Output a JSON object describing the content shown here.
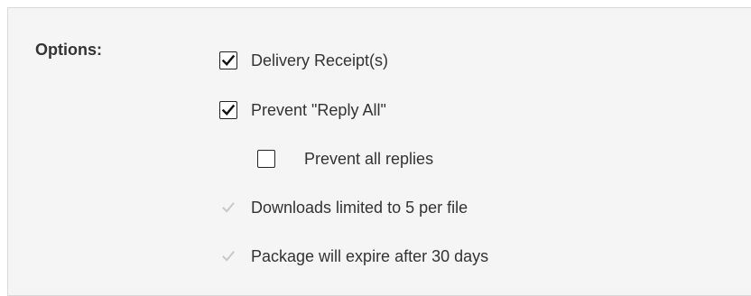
{
  "options_heading": "Options:",
  "options": [
    {
      "label": "Delivery Receipt(s)",
      "checked": true,
      "enabled": true
    },
    {
      "label": "Prevent \"Reply All\"",
      "checked": true,
      "enabled": true
    },
    {
      "label": "Prevent all replies",
      "checked": false,
      "enabled": true
    },
    {
      "label": "Downloads limited to 5 per file",
      "checked": true,
      "enabled": false
    },
    {
      "label": "Package will expire after 30 days",
      "checked": true,
      "enabled": false
    }
  ],
  "colors": {
    "panel_background": "#f5f5f5",
    "text": "#333333",
    "disabled_check": "#c8c8c8"
  }
}
